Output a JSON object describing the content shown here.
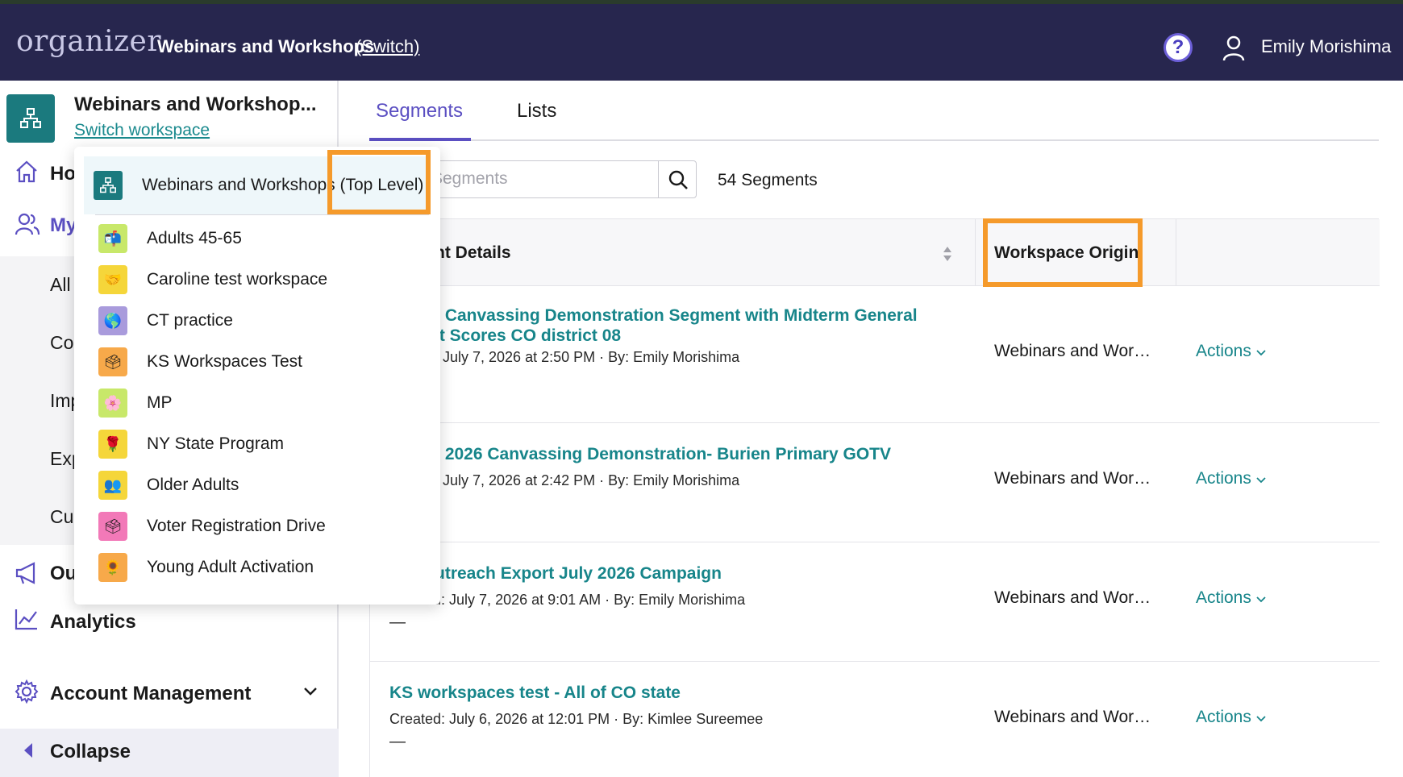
{
  "header": {
    "logo": "organizer",
    "workspace_title": "Webinars and Workshops",
    "switch_label": "(Switch)",
    "help_symbol": "?",
    "user_name": "Emily Morishima"
  },
  "sidebar": {
    "workspace_name": "Webinars and Workshop...",
    "switch_workspace": "Switch workspace",
    "nav": {
      "home": "Ho",
      "my": "My",
      "sub_all": "All",
      "sub_co": "Co",
      "sub_imp": "Imp",
      "sub_exp": "Exp",
      "sub_cu": "Cu",
      "outreach": "Ou",
      "analytics": "Analytics",
      "account": "Account Management",
      "collapse": "Collapse"
    }
  },
  "tabs": {
    "segments": "Segments",
    "lists": "Lists"
  },
  "search": {
    "placeholder": "Segments",
    "count": "54 Segments"
  },
  "table": {
    "col_details": "nt Details",
    "col_origin": "Workspace Origin",
    "rows": [
      {
        "title": "t Canvassing Demonstration Segment with Midterm General\nit Scores CO district 08",
        "meta": ": July 7, 2026 at 2:50 PM · By: Emily Morishima",
        "dash": "",
        "origin": "Webinars and Workshops",
        "actions": "Actions"
      },
      {
        "title": "t 2026 Canvassing Demonstration- Burien Primary GOTV",
        "meta": ": July 7, 2026 at 2:42 PM · By: Emily Morishima",
        "dash": "",
        "origin": "Webinars and Workshops",
        "actions": "Actions"
      },
      {
        "title": "utreach Export July 2026 Campaign",
        "meta": "Created: July 7, 2026 at 9:01 AM · By: Emily Morishima",
        "dash": "—",
        "origin": "Webinars and Workshops",
        "actions": "Actions"
      },
      {
        "title": "KS workspaces test - All of CO state",
        "meta": "Created: July 6, 2026 at 12:01 PM · By: Kimlee Sureemee",
        "dash": "—",
        "origin": "Webinars and Workshops",
        "actions": "Actions"
      }
    ]
  },
  "dropdown": {
    "top_label": "Webinars and Workshops (Top Level)",
    "items": [
      {
        "label": "Adults 45-65",
        "emoji": "📬",
        "bg": "#c8e86a"
      },
      {
        "label": "Caroline test workspace",
        "emoji": "🤝",
        "bg": "#f5d63a"
      },
      {
        "label": "CT practice",
        "emoji": "🌎",
        "bg": "#a99bdc"
      },
      {
        "label": "KS Workspaces Test",
        "emoji": "🗳",
        "bg": "#f7a94a"
      },
      {
        "label": "MP",
        "emoji": "🌸",
        "bg": "#c8e86a"
      },
      {
        "label": "NY State Program",
        "emoji": "🌹",
        "bg": "#f5d63a"
      },
      {
        "label": "Older Adults",
        "emoji": "👥",
        "bg": "#f5d63a"
      },
      {
        "label": "Voter Registration Drive",
        "emoji": "🗳",
        "bg": "#f279b8"
      },
      {
        "label": "Young Adult Activation",
        "emoji": "🌻",
        "bg": "#f7a94a"
      }
    ]
  },
  "colors": {
    "topbar": "#27264e",
    "accent": "#5b4fc2",
    "teal": "#17858a",
    "highlight": "#f59a2b"
  }
}
